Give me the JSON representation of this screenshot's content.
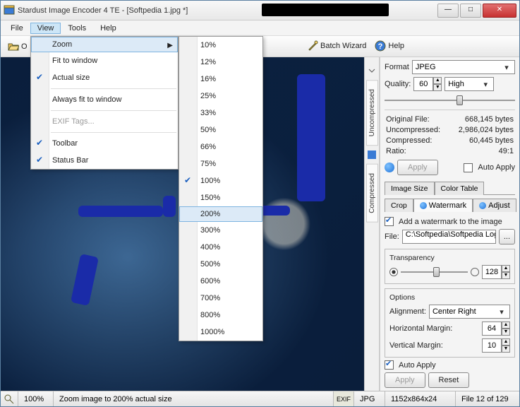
{
  "title": "Stardust Image Encoder 4 TE - [Softpedia 1.jpg *]",
  "menubar": {
    "file": "File",
    "view": "View",
    "tools": "Tools",
    "help": "Help"
  },
  "toolbar": {
    "open_prefix": "O",
    "batch": "Batch Wizard",
    "help": "Help"
  },
  "view_menu": {
    "zoom": "Zoom",
    "fit": "Fit to window",
    "actual": "Actual size",
    "always_fit": "Always fit to window",
    "exif": "EXIF Tags...",
    "toolbar": "Toolbar",
    "statusbar": "Status Bar"
  },
  "zoom_levels": [
    "10%",
    "12%",
    "16%",
    "25%",
    "33%",
    "50%",
    "66%",
    "75%",
    "100%",
    "150%",
    "200%",
    "300%",
    "400%",
    "500%",
    "600%",
    "700%",
    "800%",
    "1000%"
  ],
  "zoom_checked": "100%",
  "zoom_hover": "200%",
  "side_tabs": {
    "uncompressed": "Uncompressed",
    "compressed": "Compressed"
  },
  "panel": {
    "format_label": "Format",
    "format_value": "JPEG",
    "quality_label": "Quality:",
    "quality_value": "60",
    "quality_preset": "High",
    "stats": {
      "orig_label": "Original File:",
      "orig_val": "668,145 bytes",
      "unc_label": "Uncompressed:",
      "unc_val": "2,986,024 bytes",
      "comp_label": "Compressed:",
      "comp_val": "60,445 bytes",
      "ratio_label": "Ratio:",
      "ratio_val": "49:1"
    },
    "apply": "Apply",
    "auto_apply": "Auto Apply",
    "tabs": {
      "image_size": "Image Size",
      "color_table": "Color Table",
      "crop": "Crop",
      "watermark": "Watermark",
      "adjust": "Adjust"
    },
    "wm": {
      "add": "Add a watermark to the image",
      "file_label": "File:",
      "file_value": "C:\\Softpedia\\Softpedia Log",
      "browse": "...",
      "transparency": "Transparency",
      "trans_value": "128",
      "options": "Options",
      "alignment_label": "Alignment:",
      "alignment_value": "Center Right",
      "hmargin_label": "Horizontal Margin:",
      "hmargin_value": "64",
      "vmargin_label": "Vertical Margin:",
      "vmargin_value": "10",
      "auto_apply": "Auto Apply",
      "apply": "Apply",
      "reset": "Reset"
    }
  },
  "statusbar": {
    "zoom": "100%",
    "hint": "Zoom image to 200% actual size",
    "exif": "EXIF",
    "img_type": "JPG",
    "dims": "1152x864x24",
    "file_pos": "File 12 of 129"
  }
}
